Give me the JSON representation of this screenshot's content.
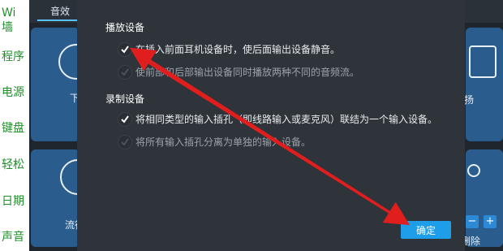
{
  "left_panel": {
    "items": [
      "Wi",
      "墙",
      "程序",
      "电源",
      "键盘",
      "轻松",
      "日期",
      "声音"
    ]
  },
  "app": {
    "tab_label": "音效",
    "background_labels": {
      "left_top": "下",
      "right_top": "扬",
      "left_bottom": "流行",
      "right_bottom": "删除"
    },
    "right_buttons": [
      "−",
      "+"
    ]
  },
  "dialog": {
    "playback_section": "播放设备",
    "playback_options": [
      {
        "label": "在插入前面耳机设备时，使后面输出设备静音。",
        "checked": true
      },
      {
        "label": "使前部和后部输出设备同时播放两种不同的音频流。",
        "checked": false
      }
    ],
    "recording_section": "录制设备",
    "recording_options": [
      {
        "label": "将相同类型的输入插孔（即线路输入或麦克风）联结为一个输入设备。",
        "checked": true
      },
      {
        "label": "将所有输入插孔分离为单独的输入设备。",
        "checked": false
      }
    ],
    "confirm_label": "确定"
  },
  "colors": {
    "accent_blue": "#1e9ee8",
    "annotation_red": "#e01e1e",
    "dialog_bg": "#2f343a",
    "left_text_green": "#1f8f2a"
  },
  "annotations": {
    "arrow_1": "from confirm button to first playback option",
    "arrow_2": "from first playback option to confirm button"
  }
}
